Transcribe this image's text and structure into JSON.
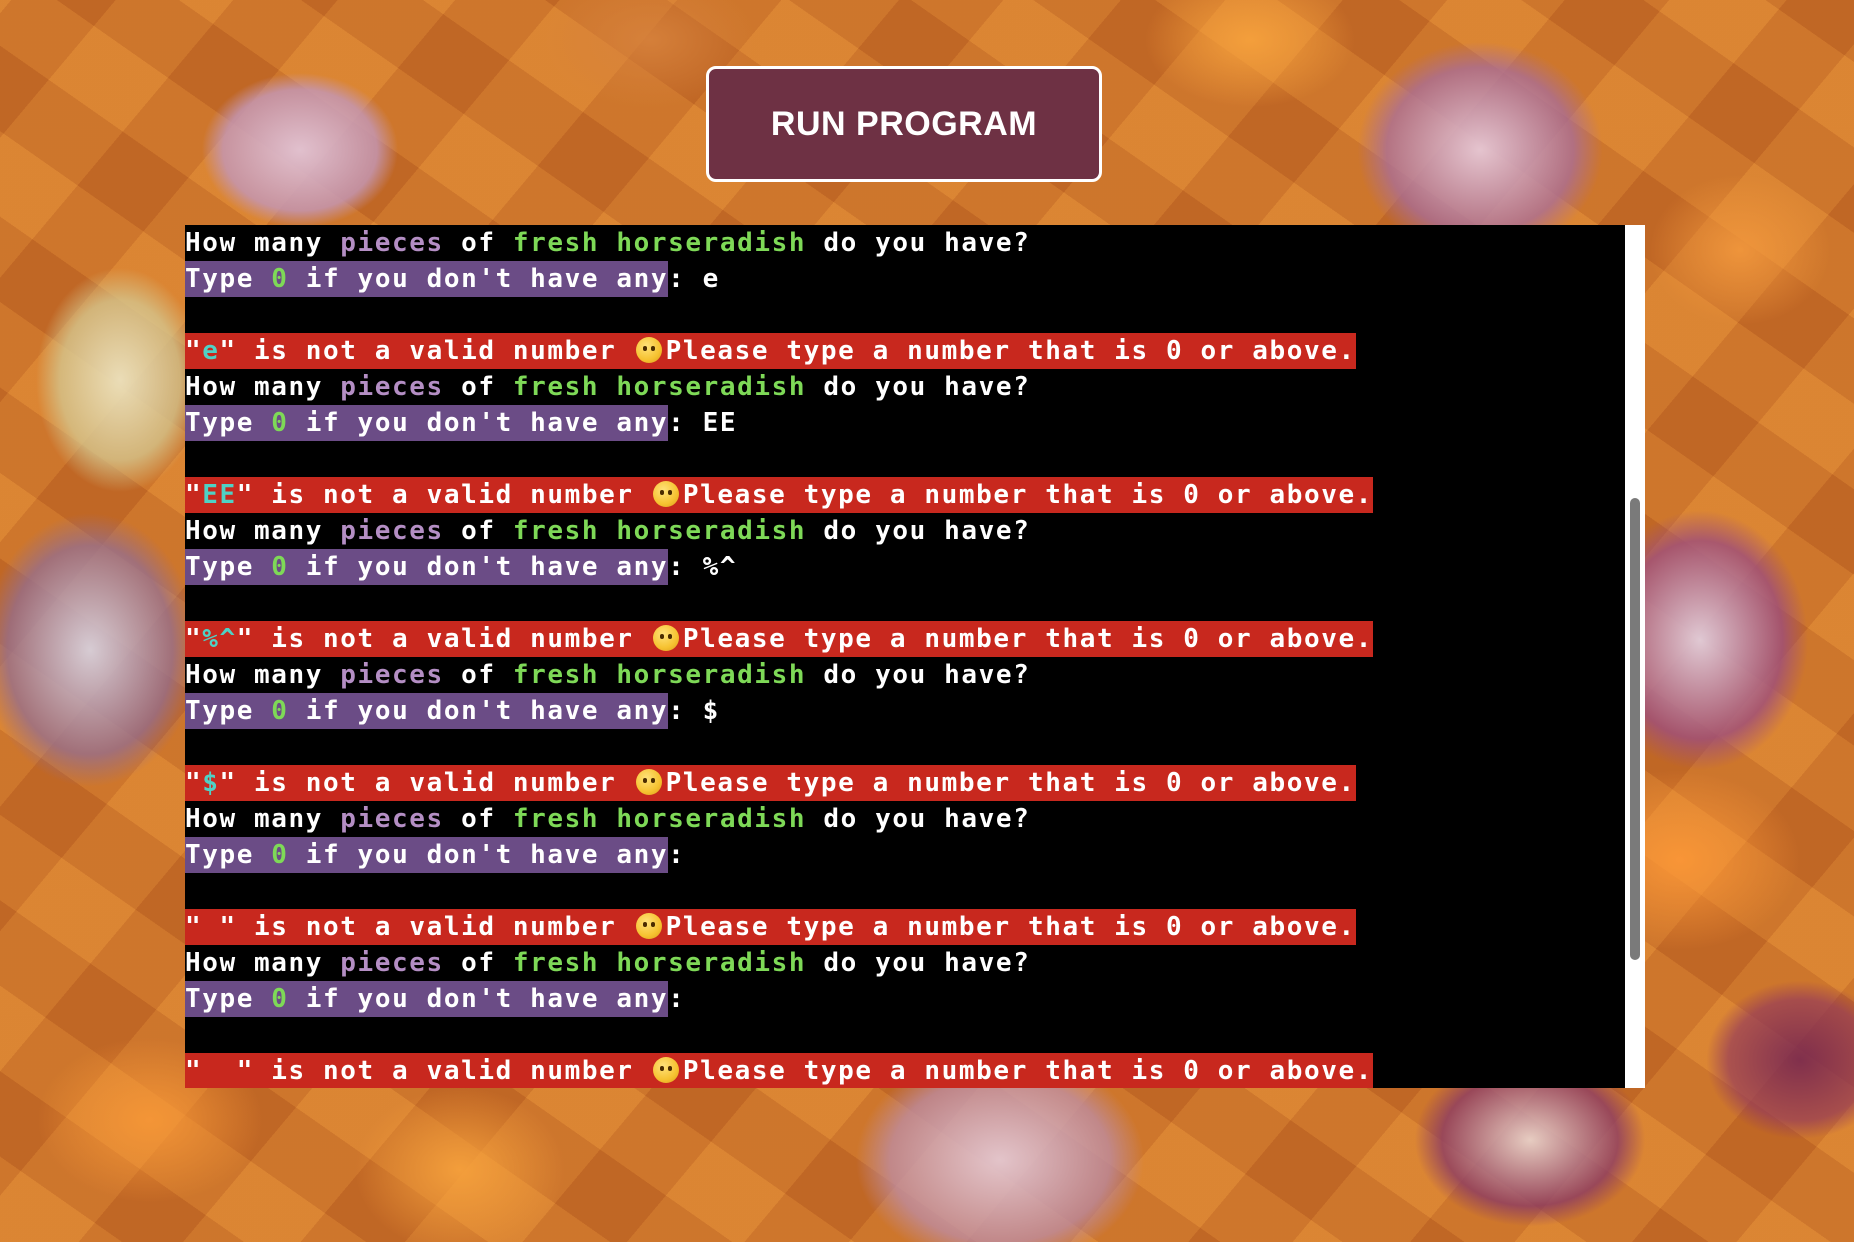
{
  "run_button": {
    "label": "RUN PROGRAM"
  },
  "terminal": {
    "question": {
      "part1": "How many ",
      "pieces": "pieces",
      "part2": " of ",
      "fresh_horseradish": "fresh horseradish",
      "part3": " do you have?"
    },
    "prompt": {
      "type_word": "Type ",
      "zero": "0",
      "rest": " if you don't have any",
      "colon": ":"
    },
    "error": {
      "is_not_valid": "\" is not a valid number ",
      "please": "Please type a number that is 0 or above."
    },
    "entries": [
      {
        "input": "e"
      },
      {
        "input": "EE"
      },
      {
        "input": "%^"
      },
      {
        "input": "$"
      },
      {
        "input": " "
      },
      {
        "input": "  "
      }
    ]
  },
  "colors": {
    "button_bg": "#6e3144",
    "highlight_purple": "#6b4c86",
    "highlight_red": "#c8281e",
    "accent_green": "#7ed957",
    "accent_lilac": "#b48ec4",
    "accent_cyan": "#4fd1c5"
  },
  "icons": {
    "error_emoji": "thinking-face-icon"
  }
}
